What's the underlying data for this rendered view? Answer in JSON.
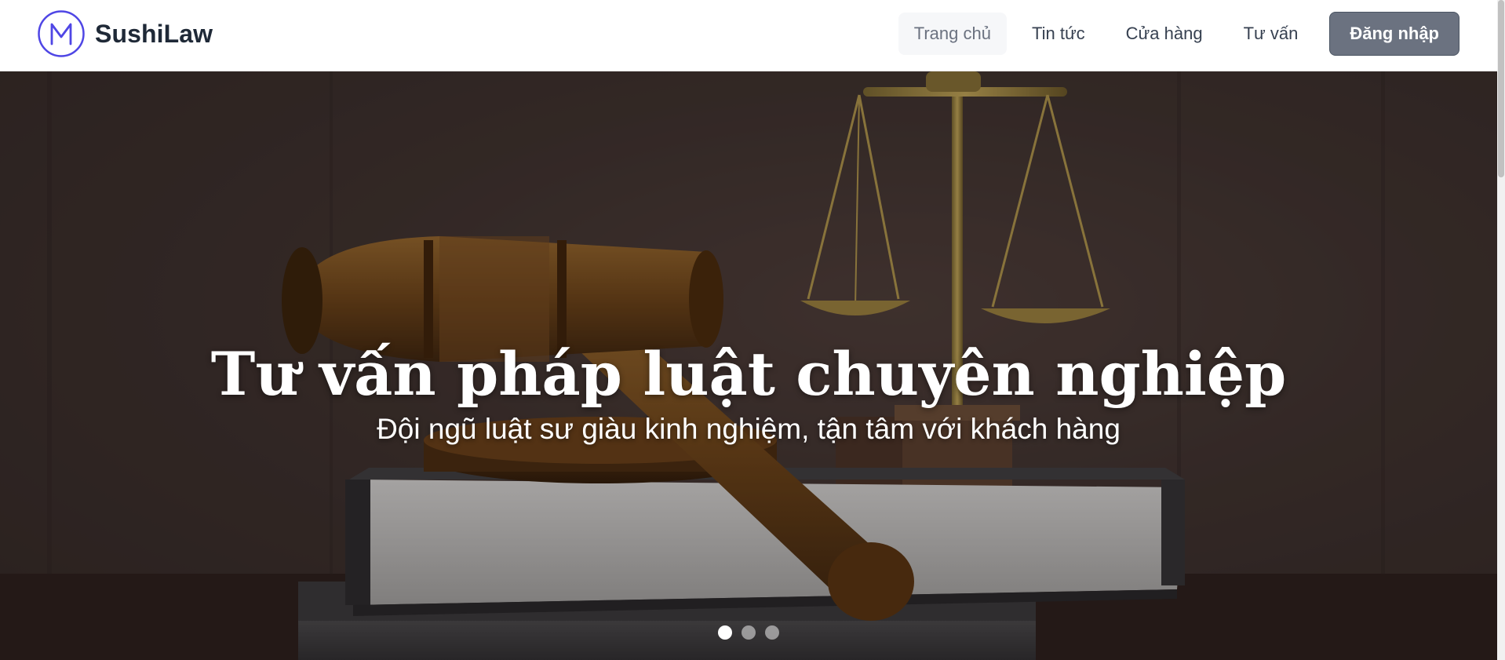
{
  "brand": {
    "name": "SushiLaw",
    "logo_icon": "m-circle-logo-icon",
    "logo_color": "#4f46e5"
  },
  "nav": {
    "items": [
      {
        "label": "Trang chủ",
        "active": true
      },
      {
        "label": "Tin tức",
        "active": false
      },
      {
        "label": "Cửa hàng",
        "active": false
      },
      {
        "label": "Tư vấn",
        "active": false
      }
    ],
    "login_label": "Đăng nhập",
    "login_color": "#6b7280"
  },
  "hero": {
    "title": "Tư vấn pháp luật chuyên nghiệp",
    "subtitle": "Đội ngũ luật sư giàu kinh nghiệm, tận tâm với khách hàng",
    "background_image": "gavel-scales-books-image",
    "slides": 3,
    "active_slide": 1
  }
}
